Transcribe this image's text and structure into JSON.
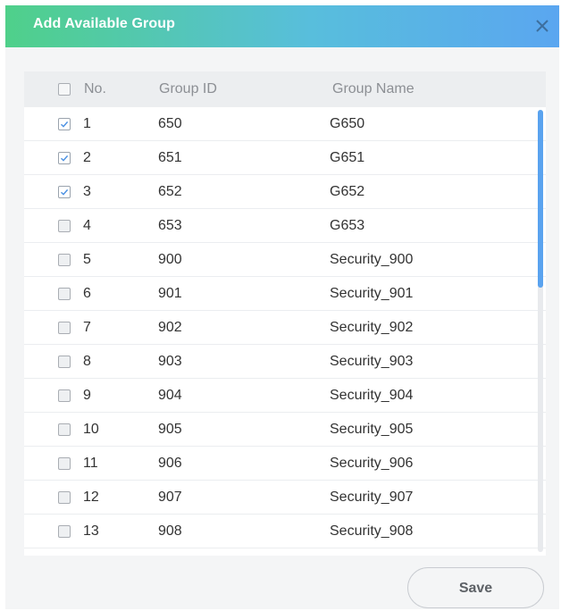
{
  "dialog": {
    "title": "Add Available Group",
    "close_icon": "close-icon"
  },
  "table": {
    "columns": {
      "no": "No.",
      "group_id": "Group ID",
      "group_name": "Group Name"
    },
    "header_checked": false,
    "rows": [
      {
        "no": "1",
        "group_id": "650",
        "group_name": "G650",
        "checked": true
      },
      {
        "no": "2",
        "group_id": "651",
        "group_name": "G651",
        "checked": true
      },
      {
        "no": "3",
        "group_id": "652",
        "group_name": "G652",
        "checked": true
      },
      {
        "no": "4",
        "group_id": "653",
        "group_name": "G653",
        "checked": false
      },
      {
        "no": "5",
        "group_id": "900",
        "group_name": "Security_900",
        "checked": false
      },
      {
        "no": "6",
        "group_id": "901",
        "group_name": "Security_901",
        "checked": false
      },
      {
        "no": "7",
        "group_id": "902",
        "group_name": "Security_902",
        "checked": false
      },
      {
        "no": "8",
        "group_id": "903",
        "group_name": "Security_903",
        "checked": false
      },
      {
        "no": "9",
        "group_id": "904",
        "group_name": "Security_904",
        "checked": false
      },
      {
        "no": "10",
        "group_id": "905",
        "group_name": "Security_905",
        "checked": false
      },
      {
        "no": "11",
        "group_id": "906",
        "group_name": "Security_906",
        "checked": false
      },
      {
        "no": "12",
        "group_id": "907",
        "group_name": "Security_907",
        "checked": false
      },
      {
        "no": "13",
        "group_id": "908",
        "group_name": "Security_908",
        "checked": false
      }
    ]
  },
  "footer": {
    "save_label": "Save"
  },
  "colors": {
    "accent": "#5aa3ef",
    "title_gradient_start": "#4fd08a",
    "title_gradient_end": "#5aa6f0",
    "check_mark": "#4a90e2"
  }
}
